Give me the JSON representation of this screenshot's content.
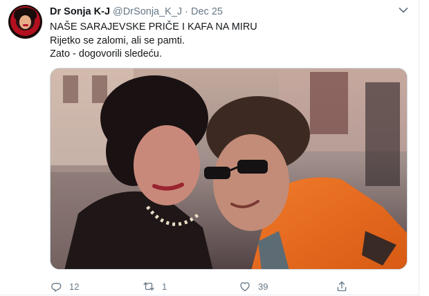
{
  "tweet": {
    "display_name": "Dr Sonja K-J",
    "handle": "@DrSonja_K_J",
    "separator": "·",
    "date": "Dec 25",
    "lines": [
      "NAŠE SARAJEVSKE PRIČE I KAFA NA MIRU",
      "Rijetko se zalomi, ali se pamti.",
      "Zato - dogovorili sledeću."
    ],
    "actions": {
      "reply_count": "12",
      "retweet_count": "1",
      "like_count": "39"
    }
  },
  "icons": {
    "more": "chevron-down-icon",
    "reply": "reply-icon",
    "retweet": "retweet-icon",
    "like": "heart-icon",
    "share": "share-icon"
  },
  "colors": {
    "text": "#14171a",
    "secondary": "#657786",
    "border": "#e6ecf0"
  }
}
